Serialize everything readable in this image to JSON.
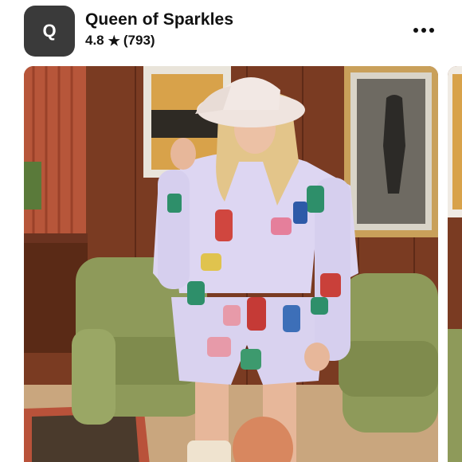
{
  "shop": {
    "logo_letter": "Q",
    "name": "Queen of Sparkles",
    "rating": "4.8",
    "review_count": "(793)"
  },
  "icons": {
    "rating_star": "star-icon",
    "more": "more-options-icon"
  },
  "colors": {
    "logo_bg": "#3a3a3a",
    "text": "#111111"
  }
}
